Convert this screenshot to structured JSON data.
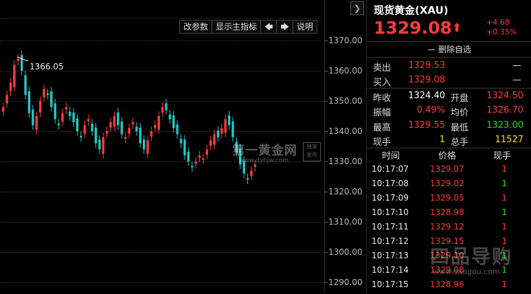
{
  "chart": {
    "expand_icon": "chevron-right-icon",
    "toolbar": {
      "params": "改参数",
      "main_indicator": "显示主指标",
      "prev": "🡄",
      "next": "🡆",
      "help": "说明"
    },
    "y_ticks": [
      "1370.00",
      "1360.00",
      "1350.00",
      "1340.00",
      "1330.00",
      "1320.00",
      "1310.00",
      "1300.00",
      "1290.00"
    ],
    "max_label": "1366.05",
    "watermark": "第一黄金网",
    "watermark_sub": "www.dyhjw.com",
    "watermark_seal": "独家 发布"
  },
  "quote": {
    "title": "现货黄金(XAU)",
    "price": "1329.08",
    "change": "+4.68",
    "change_pct": "+0.35%",
    "delete_watch": "— 删除自选",
    "sell_label": "卖出",
    "sell_price": "1329.53",
    "sell_vol": "—",
    "buy_label": "买入",
    "buy_price": "1329.08",
    "buy_vol": "—",
    "prev_close_label": "昨收",
    "prev_close": "1324.40",
    "open_label": "开盘",
    "open": "1324.50",
    "amplitude_label": "振幅",
    "amplitude": "0.49%",
    "avg_label": "均价",
    "avg": "1326.70",
    "high_label": "最高",
    "high": "1329.55",
    "low_label": "最低",
    "low": "1323.00",
    "cur_vol_label": "现手",
    "cur_vol": "1",
    "total_vol_label": "总手",
    "total_vol": "11527"
  },
  "ticks": {
    "headers": [
      "时间",
      "价格",
      "现手"
    ],
    "rows": [
      {
        "time": "10:17:07",
        "price": "1329.07",
        "vol": "1",
        "dir": "red"
      },
      {
        "time": "10:17:08",
        "price": "1329.02",
        "vol": "1",
        "dir": "green"
      },
      {
        "time": "10:17:09",
        "price": "1329.05",
        "vol": "1",
        "dir": "red"
      },
      {
        "time": "10:17:10",
        "price": "1328.98",
        "vol": "1",
        "dir": "green"
      },
      {
        "time": "10:17:11",
        "price": "1329.12",
        "vol": "1",
        "dir": "red"
      },
      {
        "time": "10:17:12",
        "price": "1329.15",
        "vol": "1",
        "dir": "red"
      },
      {
        "time": "10:17:13",
        "price": "1329.10",
        "vol": "1",
        "dir": "green"
      },
      {
        "time": "10:17:14",
        "price": "1329.08",
        "vol": "1",
        "dir": "green"
      },
      {
        "time": "10:17:15",
        "price": "1328.96",
        "vol": "1",
        "dir": "red"
      }
    ],
    "watermark": "四品导购",
    "watermark_sub": "www.daogou.com"
  }
}
